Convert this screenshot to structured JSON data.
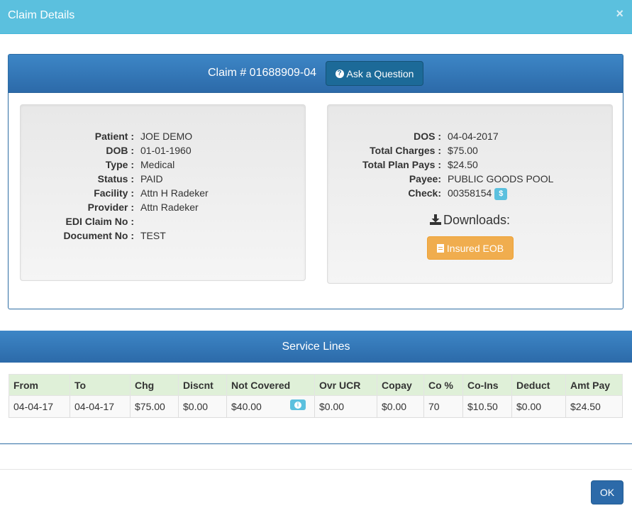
{
  "modal": {
    "title": "Claim Details",
    "close_glyph": "×",
    "ok_label": "OK"
  },
  "claim": {
    "number_label": "Claim # 01688909-04",
    "ask_button": "Ask a Question",
    "left": [
      {
        "label": "Patient :",
        "value": "JOE DEMO"
      },
      {
        "label": "DOB :",
        "value": "01-01-1960"
      },
      {
        "label": "Type :",
        "value": "Medical"
      },
      {
        "label": "Status :",
        "value": "PAID"
      },
      {
        "label": "Facility :",
        "value": "Attn H Radeker"
      },
      {
        "label": "Provider :",
        "value": "Attn Radeker"
      },
      {
        "label": "EDI Claim No :",
        "value": ""
      },
      {
        "label": "Document No :",
        "value": "TEST"
      }
    ],
    "right": [
      {
        "label": "DOS :",
        "value": "04-04-2017"
      },
      {
        "label": "Total Charges :",
        "value": "$75.00"
      },
      {
        "label": "Total Plan Pays :",
        "value": "$24.50"
      },
      {
        "label": "Payee:",
        "value": "PUBLIC GOODS POOL"
      },
      {
        "label": "Check:",
        "value": "00358154"
      }
    ],
    "check_badge": "$",
    "downloads_label": "Downloads:",
    "eob_button": "Insured EOB"
  },
  "service_lines": {
    "title": "Service Lines",
    "columns": [
      "From",
      "To",
      "Chg",
      "Discnt",
      "Not Covered",
      "Ovr UCR",
      "Copay",
      "Co %",
      "Co-Ins",
      "Deduct",
      "Amt Pay"
    ],
    "rows": [
      [
        "04-04-17",
        "04-04-17",
        "$75.00",
        "$0.00",
        "$40.00",
        "$0.00",
        "$0.00",
        "70",
        "$10.50",
        "$0.00",
        "$24.50"
      ]
    ]
  },
  "colors": {
    "header": "#5bc0de",
    "panel_blue": "#2c6aa9",
    "table_header": "#dff0d8",
    "eob_orange": "#f0ad4e"
  },
  "icons": [
    "close-icon",
    "question-circle-icon",
    "dollar-icon",
    "download-icon",
    "file-icon",
    "info-icon"
  ]
}
